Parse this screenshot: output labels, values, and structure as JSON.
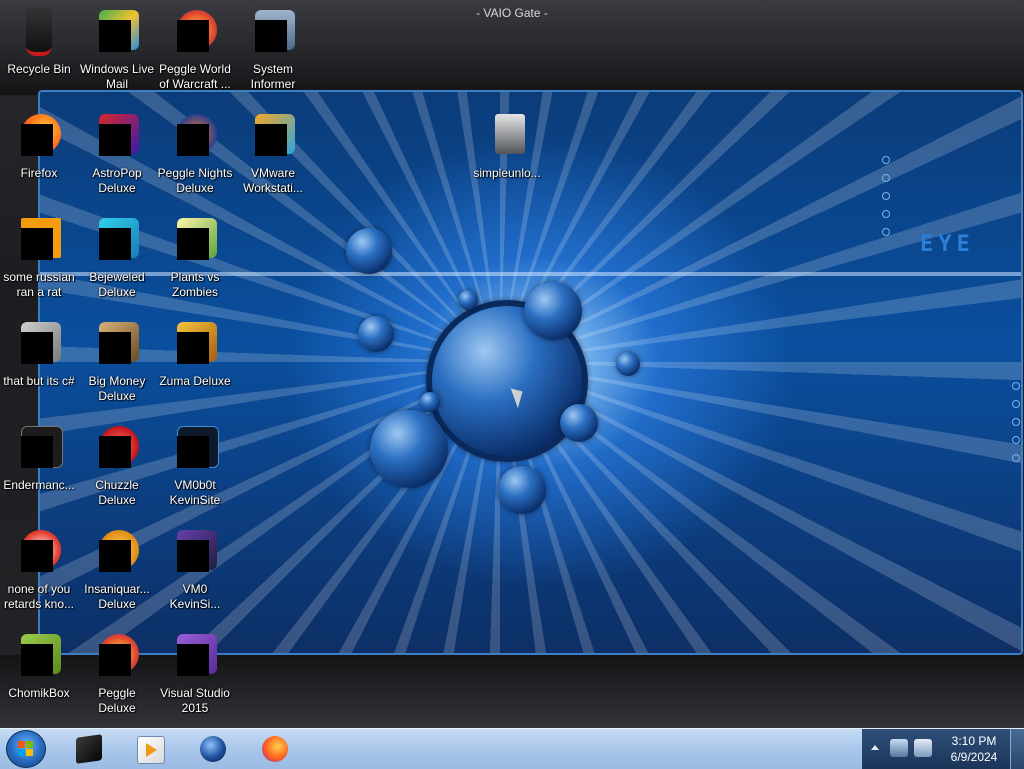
{
  "window": {
    "title": "- VAIO Gate -"
  },
  "wallpaper": {
    "eye_text": "EYE"
  },
  "desktop": {
    "icons": [
      {
        "label": "Recycle Bin"
      },
      {
        "label": "Windows Live\nMail"
      },
      {
        "label": "Peggle World\nof Warcraft ..."
      },
      {
        "label": "System\nInformer"
      },
      {
        "label": "Firefox"
      },
      {
        "label": "AstroPop\nDeluxe"
      },
      {
        "label": "Peggle Nights\nDeluxe"
      },
      {
        "label": "VMware\nWorkstati..."
      },
      {
        "label": "simpleunlo..."
      },
      {
        "label": "some russian\nran a rat"
      },
      {
        "label": "Bejeweled\nDeluxe"
      },
      {
        "label": "Plants vs\nZombies"
      },
      {
        "label": "that but its c#"
      },
      {
        "label": "Big Money\nDeluxe"
      },
      {
        "label": "Zuma Deluxe"
      },
      {
        "label": "Endermanc..."
      },
      {
        "label": "Chuzzle\nDeluxe"
      },
      {
        "label": "VM0b0t\nKevinSite"
      },
      {
        "label": "none of you\nretards kno..."
      },
      {
        "label": "Insaniquar...\nDeluxe"
      },
      {
        "label": "VM0\nKevinSi..."
      },
      {
        "label": "ChomikBox"
      },
      {
        "label": "Peggle Deluxe"
      },
      {
        "label": "Visual Studio\n2015"
      }
    ]
  },
  "taskbar": {
    "start_icon": "windows-orb-icon",
    "pinned": [
      {
        "icon": "black-cube-icon"
      },
      {
        "icon": "media-player-icon"
      },
      {
        "icon": "globe-orb-icon"
      },
      {
        "icon": "firefox-icon"
      }
    ],
    "tray": {
      "expand_icon": "chevron-up-icon",
      "icons": [
        "network-monitor-icon",
        "speaker-icon"
      ]
    },
    "clock": {
      "time": "3:10 PM",
      "date": "6/9/2024"
    }
  },
  "colors": {
    "accent_blue": "#2d7fd6",
    "taskbar": "#a9c6ea",
    "tray": "#1c3559",
    "recycle_red": "#c8191e"
  }
}
